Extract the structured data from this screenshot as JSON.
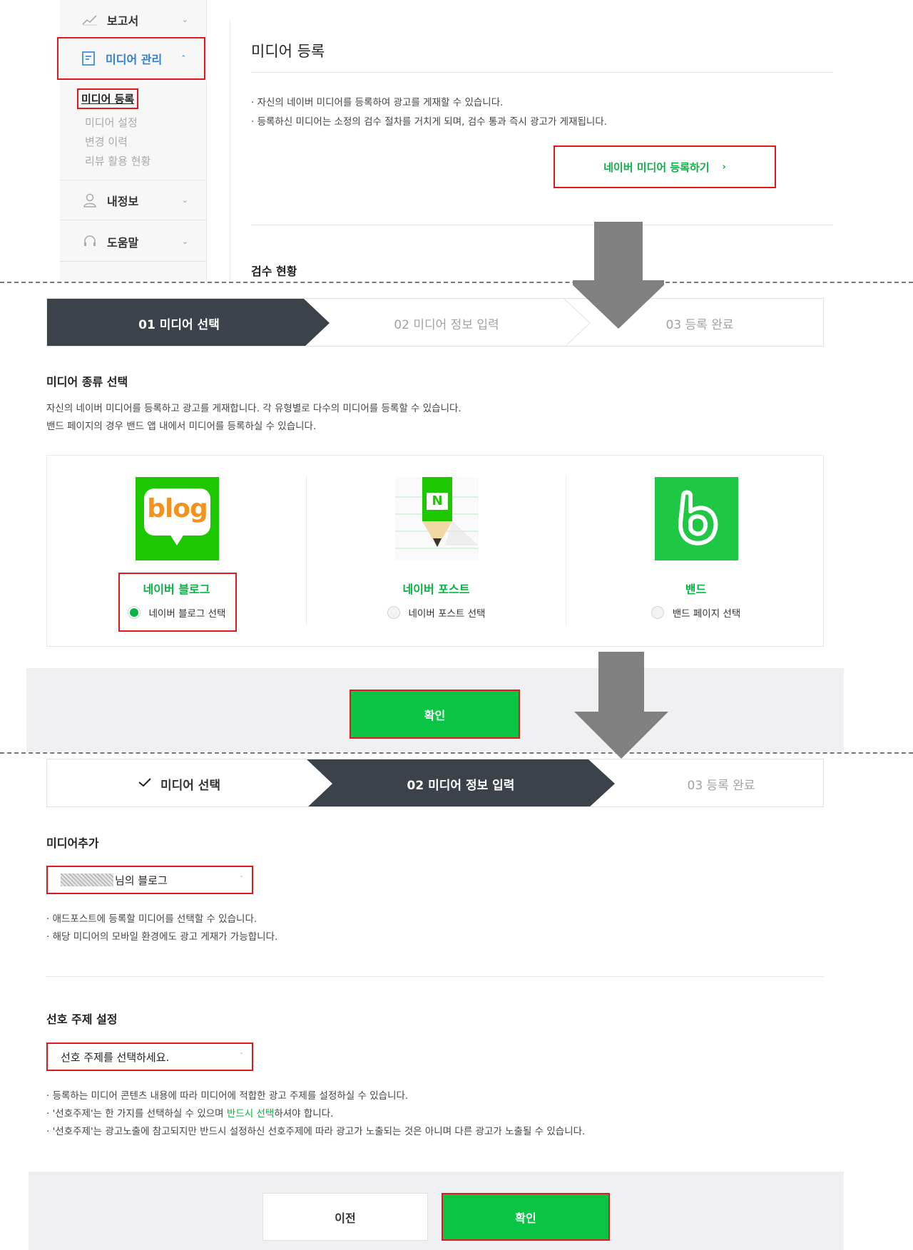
{
  "sidebar": {
    "items": [
      {
        "label": "보고서",
        "icon": "chart-line-icon"
      },
      {
        "label": "미디어 관리",
        "icon": "document-icon"
      },
      {
        "label": "내정보",
        "icon": "user-icon"
      },
      {
        "label": "도움말",
        "icon": "headset-icon"
      }
    ],
    "sub_items": [
      "미디어 등록",
      "미디어 설정",
      "변경 이력",
      "리뷰 활용 현황"
    ]
  },
  "register_page": {
    "title": "미디어 등록",
    "notes": [
      "· 자신의 네이버 미디어를 등록하여 광고를 게재할 수 있습니다.",
      "· 등록하신 미디어는 소정의 검수 절차를 거치게 되며, 검수 통과 즉시 광고가 게재됩니다."
    ],
    "register_button": "네이버 미디어 등록하기",
    "review_status_title": "검수 현황"
  },
  "step_panel_1": {
    "steps": [
      "01  미디어 선택",
      "02  미디어 정보 입력",
      "03  등록 완료"
    ],
    "section_title": "미디어 종류 선택",
    "desc": [
      "자신의 네이버 미디어를 등록하고 광고를 게재합니다. 각 유형별로 다수의 미디어를 등록할 수 있습니다.",
      "밴드 페이지의 경우 밴드 앱 내에서 미디어를 등록하실 수 있습니다."
    ],
    "media": [
      {
        "name": "네이버 블로그",
        "radio_label": "네이버 블로그 선택",
        "selected": true,
        "logo_text": "blog"
      },
      {
        "name": "네이버 포스트",
        "radio_label": "네이버 포스트 선택",
        "selected": false,
        "logo_text": "N"
      },
      {
        "name": "밴드",
        "radio_label": "밴드 페이지 선택",
        "selected": false,
        "logo_text": "b"
      }
    ],
    "confirm_button": "확인"
  },
  "step_panel_2": {
    "steps": [
      "미디어 선택",
      "02  미디어 정보 입력",
      "03  등록 완료"
    ],
    "media_add_title": "미디어추가",
    "media_select_value": "님의 블로그",
    "media_notes": [
      "· 애드포스트에 등록할 미디어를 선택할 수 있습니다.",
      "· 해당 미디어의 모바일 환경에도 광고 게재가 가능합니다."
    ],
    "topic_title": "선호 주제 설정",
    "topic_placeholder": "선호 주제를 선택하세요.",
    "topic_notes": {
      "line1": "· 등록하는 미디어 콘텐츠 내용에 따라 미디어에 적합한 광고 주제를 설정하실 수 있습니다.",
      "line2_pre": "· '선호주제'는 한 가지를 선택하실 수 있으며 ",
      "line2_em": "반드시 선택",
      "line2_post": "하셔야 합니다.",
      "line3": "· '선호주제'는 광고노출에 참고되지만 반드시 설정하신 선호주제에 따라 광고가 노출되는 것은 아니며 다른 광고가 노출될 수 있습니다."
    },
    "prev_button": "이전",
    "confirm_button": "확인"
  },
  "colors": {
    "naver_green": "#0ac443",
    "highlight_red": "#e0191f",
    "step_dark": "#3b424a",
    "arrow_gray": "#808080"
  }
}
